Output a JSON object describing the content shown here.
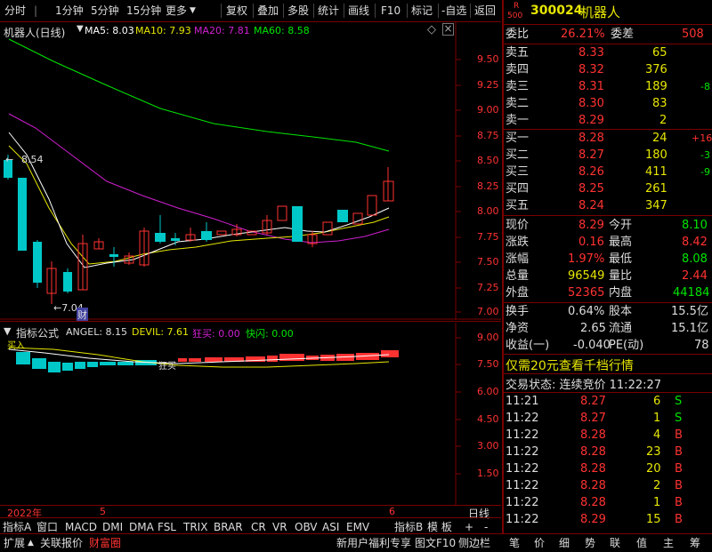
{
  "toolbar": {
    "left_items": [
      "分时",
      "1分钟",
      "5分钟",
      "15分钟",
      "更多"
    ],
    "right_items": [
      "复权",
      "叠加",
      "多股",
      "统计",
      "画线",
      "F10",
      "标记",
      "-自选",
      "返回"
    ]
  },
  "main_chart": {
    "title": "机器人(日线)",
    "ma5": "MA5: 8.03",
    "ma10": "MA10: 7.93",
    "ma20": "MA20: 7.81",
    "ma60": "MA60: 8.58",
    "price_ticks": [
      "9.50",
      "9.25",
      "9.00",
      "8.75",
      "8.50",
      "8.25",
      "8.00",
      "7.75",
      "7.50",
      "7.25",
      "7.00"
    ],
    "high_label": "8.54",
    "low_label": "←7.04",
    "low_marker": "财"
  },
  "indicator_chart": {
    "name": "指标公式",
    "angel": "ANGEL: 8.15",
    "devil": "DEVIL: 7.61",
    "kuangmai": "狂买: 0.00",
    "kuaishan": "快闪: 0.00",
    "ticks": [
      "9.00",
      "7.50",
      "6.00",
      "4.50",
      "3.00",
      "1.50"
    ],
    "annotation_buy": "买入",
    "annotation_sell": "狂买"
  },
  "date_axis": {
    "year": "2022年",
    "m5": "5",
    "m6": "6",
    "period": "日线"
  },
  "indicator_tabs": [
    "指标A",
    "窗口",
    "MACD",
    "DMI",
    "DMA",
    "FSL",
    "TRIX",
    "BRAR",
    "CR",
    "VR",
    "OBV",
    "ASI",
    "EMV",
    "指标B",
    "模 板",
    "+",
    "-"
  ],
  "bottom_tabs_left": [
    "扩展",
    "关联报价",
    "财富圈"
  ],
  "bottom_tabs_right": [
    "新用户福利专享",
    "图文F10",
    "侧边栏",
    "笔",
    "价",
    "细",
    "势",
    "联",
    "值",
    "主",
    "筹"
  ],
  "quote": {
    "code": "300024",
    "name": "机器人",
    "badge_top": "R",
    "badge_bottom": "500",
    "weibi_label": "委比",
    "weibi": "26.21%",
    "weicha_label": "委差",
    "weicha": "508",
    "asks": [
      {
        "label": "卖五",
        "price": "8.33",
        "vol": "65",
        "chg": ""
      },
      {
        "label": "卖四",
        "price": "8.32",
        "vol": "376",
        "chg": ""
      },
      {
        "label": "卖三",
        "price": "8.31",
        "vol": "189",
        "chg": "-8"
      },
      {
        "label": "卖二",
        "price": "8.30",
        "vol": "83",
        "chg": ""
      },
      {
        "label": "卖一",
        "price": "8.29",
        "vol": "2",
        "chg": ""
      }
    ],
    "bids": [
      {
        "label": "买一",
        "price": "8.28",
        "vol": "24",
        "chg": "+16"
      },
      {
        "label": "买二",
        "price": "8.27",
        "vol": "180",
        "chg": "-3"
      },
      {
        "label": "买三",
        "price": "8.26",
        "vol": "411",
        "chg": "-9"
      },
      {
        "label": "买四",
        "price": "8.25",
        "vol": "261",
        "chg": ""
      },
      {
        "label": "买五",
        "price": "8.24",
        "vol": "347",
        "chg": ""
      }
    ],
    "stats": [
      {
        "l1": "现价",
        "v1": "8.29",
        "l2": "今开",
        "v2": "8.10"
      },
      {
        "l1": "涨跌",
        "v1": "0.16",
        "l2": "最高",
        "v2": "8.42"
      },
      {
        "l1": "涨幅",
        "v1": "1.97%",
        "l2": "最低",
        "v2": "8.08"
      },
      {
        "l1": "总量",
        "v1": "96549",
        "l2": "量比",
        "v2": "2.44"
      },
      {
        "l1": "外盘",
        "v1": "52365",
        "l2": "内盘",
        "v2": "44184"
      }
    ],
    "stats2": [
      {
        "l1": "换手",
        "v1": "0.64%",
        "l2": "股本",
        "v2": "15.5亿"
      },
      {
        "l1": "净资",
        "v1": "2.65",
        "l2": "流通",
        "v2": "15.1亿"
      },
      {
        "l1": "收益(一)",
        "v1": "-0.040",
        "l2": "PE(动)",
        "v2": "78"
      }
    ],
    "promo": "仅需20元查看千档行情",
    "trade_state": "交易状态: 连续竞价 11:22:27",
    "ticks": [
      {
        "t": "11:21",
        "p": "8.27",
        "v": "6",
        "s": "S"
      },
      {
        "t": "11:22",
        "p": "8.27",
        "v": "1",
        "s": "S"
      },
      {
        "t": "11:22",
        "p": "8.28",
        "v": "4",
        "s": "B"
      },
      {
        "t": "11:22",
        "p": "8.28",
        "v": "23",
        "s": "B"
      },
      {
        "t": "11:22",
        "p": "8.28",
        "v": "20",
        "s": "B"
      },
      {
        "t": "11:22",
        "p": "8.28",
        "v": "2",
        "s": "B"
      },
      {
        "t": "11:22",
        "p": "8.28",
        "v": "1",
        "s": "B"
      },
      {
        "t": "11:22",
        "p": "8.29",
        "v": "15",
        "s": "B"
      }
    ]
  },
  "colors": {
    "up": "#ff3232",
    "down": "#00e600",
    "accent_border": "#7a0000",
    "ma5": "#ffffff",
    "ma10": "#e6e600",
    "ma20": "#d020d0",
    "ma60": "#00e600"
  }
}
